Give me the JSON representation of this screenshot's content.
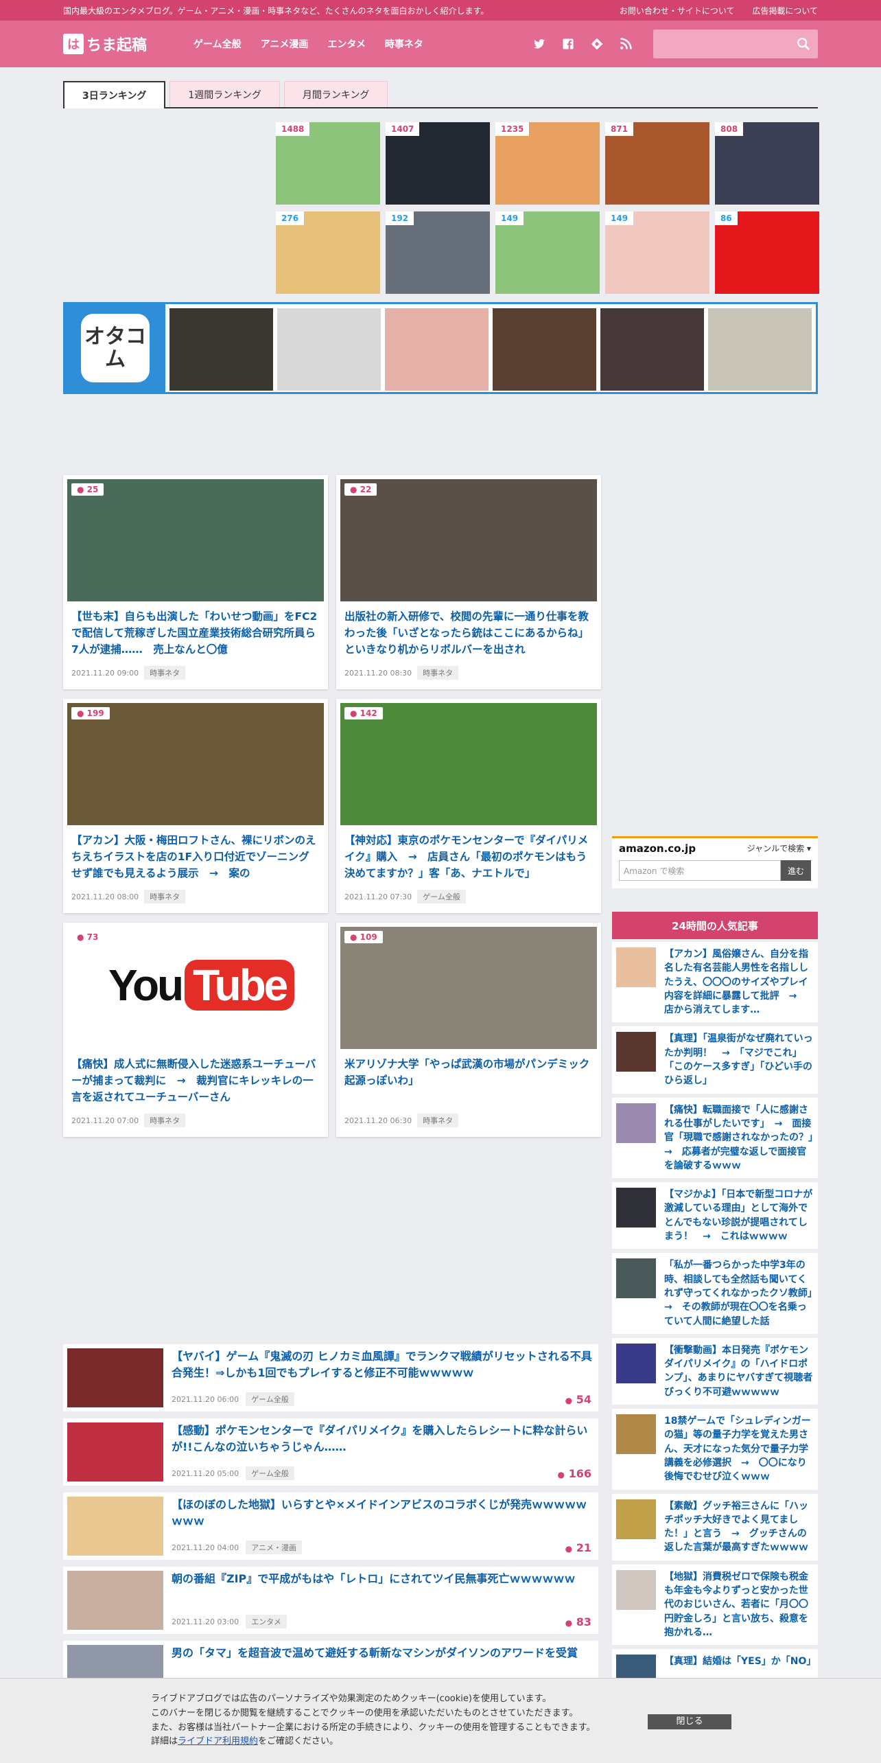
{
  "topbar": {
    "tagline": "国内最大級のエンタメブログ。ゲーム・アニメ・漫画・時事ネタなど、たくさんのネタを面白おかしく紹介します。",
    "links": [
      "お問い合わせ・サイトについて",
      "広告掲載について"
    ]
  },
  "header": {
    "logo_mark": "は",
    "logo_text": "ちま起稿",
    "nav": [
      "ゲーム全般",
      "アニメ漫画",
      "エンタメ",
      "時事ネタ"
    ]
  },
  "tabs": [
    "3日ランキング",
    "1週間ランキング",
    "月間ランキング"
  ],
  "ranking": [
    {
      "count": "1488",
      "kind": "comment",
      "color": "#8cc47c"
    },
    {
      "count": "1407",
      "kind": "comment",
      "color": "#222831"
    },
    {
      "count": "1235",
      "kind": "comment",
      "color": "#e8a060"
    },
    {
      "count": "871",
      "kind": "comment",
      "color": "#a8582c"
    },
    {
      "count": "808",
      "kind": "comment",
      "color": "#3b3f53"
    },
    {
      "count": "276",
      "kind": "twitter",
      "color": "#e7c07a"
    },
    {
      "count": "192",
      "kind": "twitter",
      "color": "#67707a"
    },
    {
      "count": "149",
      "kind": "twitter",
      "color": "#8cc47c"
    },
    {
      "count": "149",
      "kind": "twitter",
      "color": "#f0c8c0"
    },
    {
      "count": "86",
      "kind": "twitter",
      "color": "#e4181b"
    }
  ],
  "otacom": {
    "logo": "オタコム",
    "colors": [
      "#3a3630",
      "#d8d8d8",
      "#e4b0a8",
      "#5a4030",
      "#463838",
      "#c8c4b8"
    ]
  },
  "cards": [
    {
      "count": "25",
      "title": "【世も末】自らも出演した「わいせつ動画」をFC2で配信して荒稼ぎした国立産業技術総合研究所員ら7人が逮捕……　売上なんと〇億",
      "date": "2021.11.20 09:00",
      "tag": "時事ネタ",
      "color": "#4a6a5a"
    },
    {
      "count": "22",
      "title": "出版社の新入研修で、校閲の先輩に一通り仕事を教わった後「いざとなったら銃はここにあるからね」といきなり机からリボルバーを出され",
      "date": "2021.11.20 08:30",
      "tag": "時事ネタ",
      "color": "#5a5048"
    },
    {
      "count": "199",
      "title": "【アカン】大阪・梅田ロフトさん、裸にリボンのえちえちイラストを店の1F入り口付近でゾーニングせず誰でも見えるよう展示　→　案の",
      "date": "2021.11.20 08:00",
      "tag": "時事ネタ",
      "color": "#6a5a38"
    },
    {
      "count": "142",
      "title": "【神対応】東京のポケモンセンターで『ダイパリメイク』購入　→　店員さん「最初のポケモンはもう決めてますか？」客「あ、ナエトルで」",
      "date": "2021.11.20 07:30",
      "tag": "ゲーム全般",
      "color": "#4f8a3c"
    },
    {
      "count": "73",
      "title": "【痛快】成人式に無断侵入した迷惑系ユーチューバーが捕まって裁判に　→　裁判官にキレッキレの一言を返されてユーチューバーさん",
      "date": "2021.11.20 07:00",
      "tag": "時事ネタ",
      "color": "#ffffff",
      "youtube": {
        "you": "You",
        "tube": "Tube"
      }
    },
    {
      "count": "109",
      "title": "米アリゾナ大学「やっぱ武漢の市場がパンデミック起源っぽいわ」",
      "date": "2021.11.20 06:30",
      "tag": "時事ネタ",
      "color": "#8a8478"
    }
  ],
  "list": [
    {
      "title": "【ヤバイ】ゲーム『鬼滅の刃 ヒノカミ血風譚』でランクマ戦績がリセットされる不具合発生！⇒しかも1回でもプレイすると修正不可能ｗｗｗｗｗ",
      "date": "2021.11.20 06:00",
      "tag": "ゲーム全般",
      "count": "54",
      "color": "#7a2a2a"
    },
    {
      "title": "【感動】ポケモンセンターで『ダイパリメイク』を購入したらレシートに粋な計らいが!!こんなの泣いちゃうじゃん……",
      "date": "2021.11.20 05:00",
      "tag": "ゲーム全般",
      "count": "166",
      "color": "#c03040"
    },
    {
      "title": "【ほのぼのした地獄】いらすとや×メイドインアビスのコラボくじが発売ｗｗｗｗｗｗｗｗ",
      "date": "2021.11.20 04:00",
      "tag": "アニメ・漫画",
      "count": "21",
      "color": "#e8c890"
    },
    {
      "title": "朝の番組『ZIP』で平成がもはや「レトロ」にされてツイ民無事死亡ｗｗｗｗｗｗ",
      "date": "2021.11.20 03:00",
      "tag": "エンタメ",
      "count": "83",
      "color": "#c8b0a0"
    },
    {
      "title": "男の「タマ」を超音波で温めて避妊する斬新なマシンがダイソンのアワードを受賞",
      "date": "",
      "tag": "",
      "count": "",
      "color": "#9098a8"
    }
  ],
  "amazon": {
    "logo": "amazon.co.jp",
    "genre": "ジャンルで検索",
    "placeholder": "Amazon で検索",
    "button": "進む"
  },
  "popular": {
    "heading": "24時間の人気記事",
    "items": [
      {
        "title": "【アカン】風俗嬢さん、自分を指名した有名芸能人男性を名指ししたうえ、〇〇〇のサイズやプレイ内容を詳細に暴露して批評　→　店から消えてします…",
        "color": "#e8c0a0"
      },
      {
        "title": "【真理】「温泉街がなぜ廃れていったか判明！　→　「マジでこれ」「このケース多すぎ」「ひどい手のひら返し」",
        "color": "#5a3830"
      },
      {
        "title": "【痛快】転職面接で「人に感謝される仕事がしたいです」　→　面接官「現職で感謝されなかったの？」　→　応募者が完璧な返しで面接官を論破するｗｗｗ",
        "color": "#9a8ab0"
      },
      {
        "title": "【マジかよ】「日本で新型コロナが激減している理由」として海外でとんでもない珍説が提唱されてしまう！　→　これはｗｗｗｗ",
        "color": "#303038"
      },
      {
        "title": "「私が一番つらかった中学3年の時、相談しても全然話も聞いてくれず守ってくれなかったクソ教師」　→　その教師が現在〇〇を名乗っていて人間に絶望した話",
        "color": "#4a5a5a"
      },
      {
        "title": "【衝撃動画】本日発売『ポケモン ダイパリメイク』の「ハイドロポンプ」、あまりにヤバすぎて視聴者びっくり不可避ｗｗｗｗｗ",
        "color": "#3a3a8a"
      },
      {
        "title": "18禁ゲームで「シュレディンガーの猫」等の量子力学を覚えた男さん、天才になった気分で量子力学講義を必修選択　→　〇〇になり後悔でむせび泣くｗｗｗ",
        "color": "#b08848"
      },
      {
        "title": "【素敵】グッチ裕三さんに「ハッチポッチ大好きでよく見てました！」と言う　→　グッチさんの返した言葉が最高すぎたｗｗｗｗ",
        "color": "#c0a048"
      },
      {
        "title": "【地獄】消費税ゼロで保険も税金も年金も今よりずっと安かった世代のおじいさん、若者に「月〇〇円貯金しろ」と言い放ち、殺意を抱かれる…",
        "color": "#d0c8c0"
      },
      {
        "title": "【真理】結婚は「YES」か「NO」",
        "color": "#3a5a7a"
      }
    ]
  },
  "cookie": {
    "lines": [
      "ライブドアブログでは広告のパーソナライズや効果測定のためクッキー(cookie)を使用しています。",
      "このバナーを閉じるか閲覧を継続することでクッキーの使用を承認いただいたものとさせていただきます。",
      "また、お客様は当社パートナー企業における所定の手続きにより、クッキーの使用を管理することもできます。"
    ],
    "prefix": "詳細は",
    "link": "ライブドア利用規約",
    "suffix": "をご確認ください。",
    "button": "閉じる"
  }
}
